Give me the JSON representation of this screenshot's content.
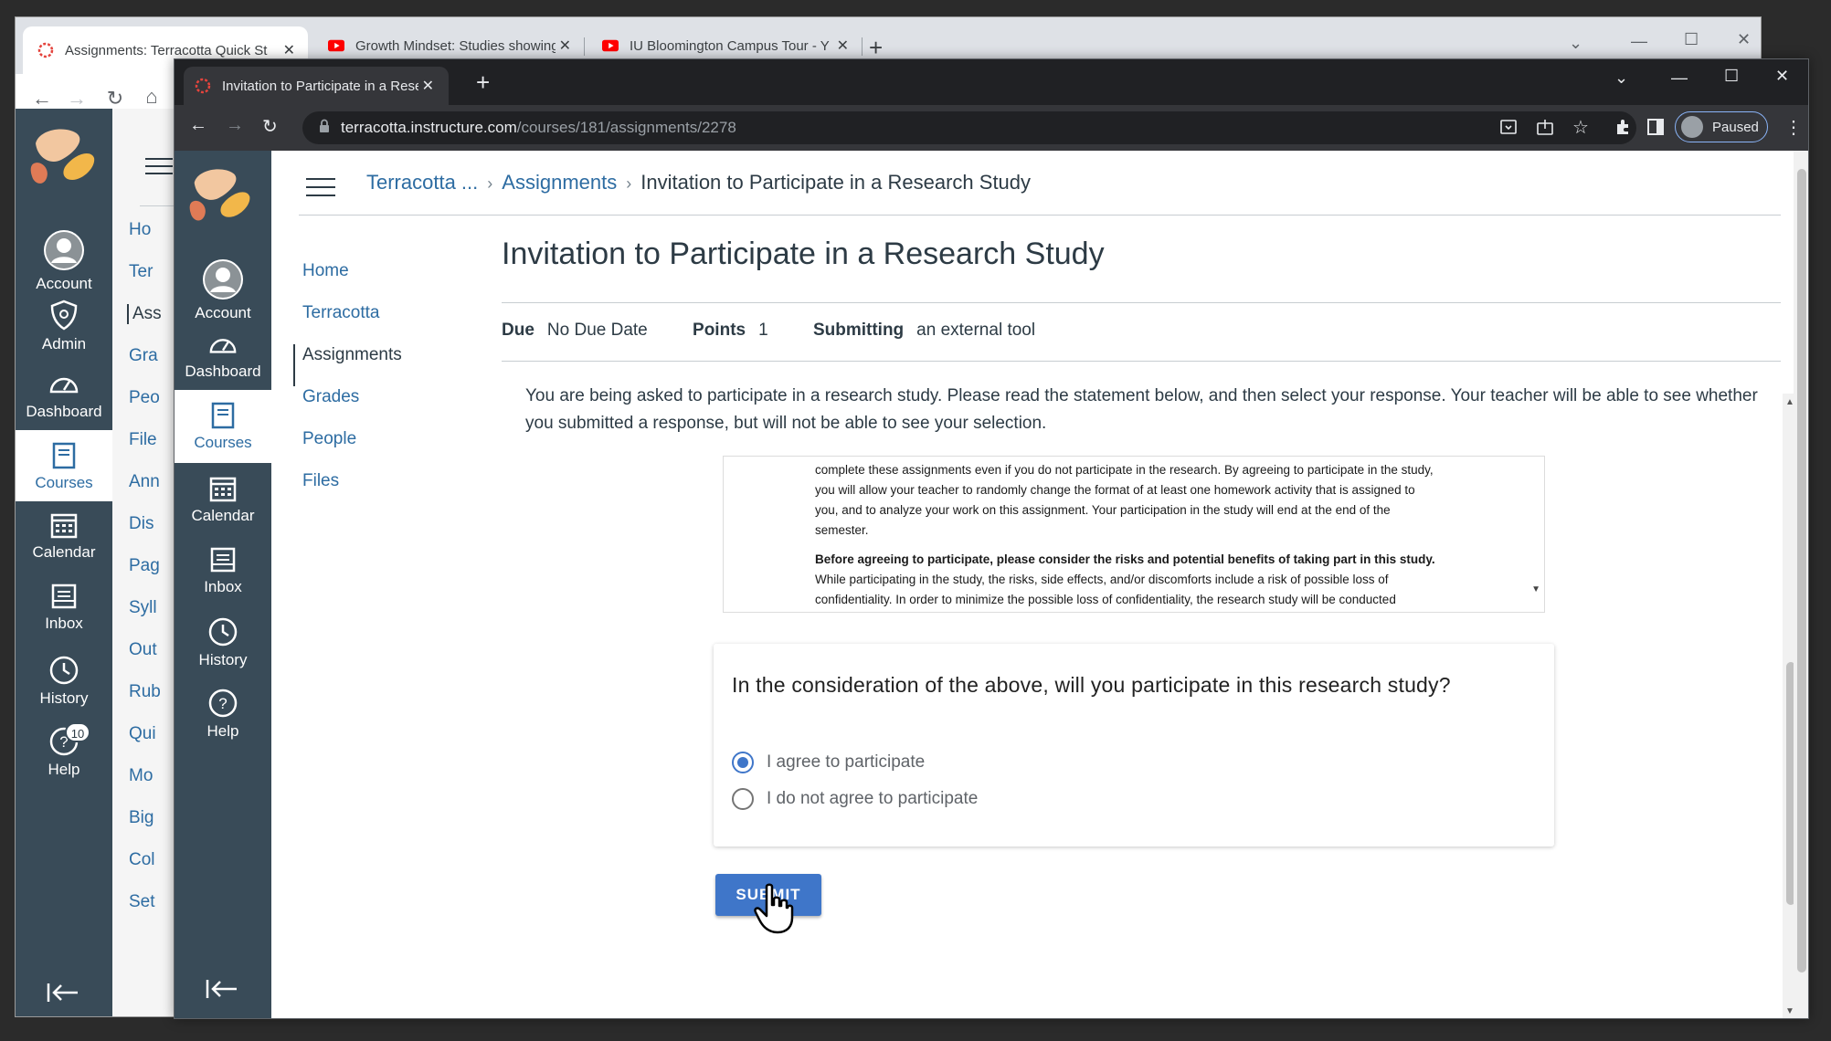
{
  "bg_browser": {
    "tabs": [
      {
        "title": "Assignments: Terracotta Quick St",
        "icon": "canvas-icon"
      },
      {
        "title": "Growth Mindset: Studies showing",
        "icon": "youtube-icon"
      },
      {
        "title": "IU Bloomington Campus Tour - Y",
        "icon": "youtube-icon"
      }
    ],
    "new_tab": "+"
  },
  "bg_canvas": {
    "global_nav": [
      {
        "label": "Account",
        "icon": "avatar-icon"
      },
      {
        "label": "Admin",
        "icon": "shield-icon"
      },
      {
        "label": "Dashboard",
        "icon": "speedometer-icon"
      },
      {
        "label": "Courses",
        "icon": "book-icon"
      },
      {
        "label": "Calendar",
        "icon": "calendar-icon"
      },
      {
        "label": "Inbox",
        "icon": "inbox-icon"
      },
      {
        "label": "History",
        "icon": "clock-icon"
      },
      {
        "label": "Help",
        "icon": "help-icon",
        "badge": "10"
      }
    ],
    "course_nav_partial": [
      "Ho",
      "Ter",
      "Ass",
      "Gra",
      "Peo",
      "File",
      "Ann",
      "Dis",
      "Pag",
      "Syll",
      "Out",
      "Rub",
      "Qui",
      "Mo",
      "Big",
      "Col",
      "Set"
    ]
  },
  "fg_browser": {
    "tab_title": "Invitation to Participate in a Rese",
    "new_tab": "+",
    "url_host": "terracotta.instructure.com",
    "url_path": "/courses/181/assignments/2278",
    "profile_status": "Paused"
  },
  "fg_canvas": {
    "global_nav": [
      {
        "label": "Account",
        "icon": "avatar-icon"
      },
      {
        "label": "Dashboard",
        "icon": "speedometer-icon"
      },
      {
        "label": "Courses",
        "icon": "book-icon"
      },
      {
        "label": "Calendar",
        "icon": "calendar-icon"
      },
      {
        "label": "Inbox",
        "icon": "inbox-icon"
      },
      {
        "label": "History",
        "icon": "clock-icon"
      },
      {
        "label": "Help",
        "icon": "help-icon"
      }
    ],
    "breadcrumbs": [
      "Terracotta ...",
      "Assignments",
      "Invitation to Participate in a Research Study"
    ],
    "course_nav": [
      "Home",
      "Terracotta",
      "Assignments",
      "Grades",
      "People",
      "Files"
    ],
    "active_course_nav": "Assignments"
  },
  "assignment": {
    "title": "Invitation to Participate in a Research Study",
    "due_label": "Due",
    "due_value": "No Due Date",
    "points_label": "Points",
    "points_value": "1",
    "submitting_label": "Submitting",
    "submitting_value": "an external tool",
    "intro": "You are being asked to participate in a research study. Please read the statement below, and then select your response. Your teacher will be able to see whether you submitted a response, but will not be able to see your selection.",
    "consent_p1": "complete these assignments even if you do not participate in the research. By agreeing to participate in the study, you will allow your teacher to randomly change the format of at least one homework activity that is assigned to you, and to analyze your work on this assignment.  Your participation in the study will end at the end of the semester.",
    "consent_p2_bold": "Before agreeing to participate, please consider the risks and potential benefits of taking part in this study.",
    "consent_p2_rest": " While participating in the study, the risks, side effects, and/or discomforts include a risk of possible loss of confidentiality.  In order to minimize the possible loss of confidentiality, the research study will be conducted electronically within Canvas. Your decision to participate, as well as your",
    "question": "In the consideration of the above, will you participate in this research study?",
    "options": [
      "I agree to participate",
      "I do not agree to participate"
    ],
    "selected_option": "I agree to participate",
    "submit_label": "SUBMIT"
  },
  "colors": {
    "canvas_nav": "#394b58",
    "link": "#2d6ca2",
    "primary": "#3f76c9",
    "text": "#2d3b45"
  }
}
